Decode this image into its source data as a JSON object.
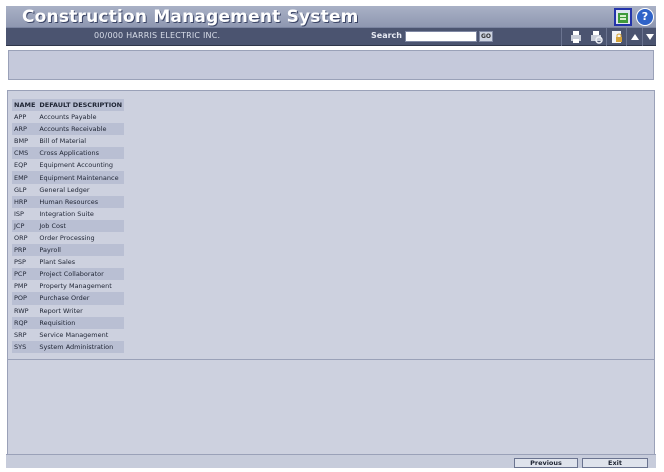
{
  "app": {
    "title": "Construction Management System"
  },
  "toolbar": {
    "company": "00/000  HARRIS ELECTRIC INC.",
    "search_label": "Search",
    "search_value": "",
    "go_label": "GO"
  },
  "table": {
    "headers": {
      "name": "NAME",
      "description": "DEFAULT DESCRIPTION"
    },
    "rows": [
      {
        "code": "APP",
        "description": "Accounts Payable"
      },
      {
        "code": "ARP",
        "description": "Accounts Receivable"
      },
      {
        "code": "BMP",
        "description": "Bill of Material"
      },
      {
        "code": "CMS",
        "description": "Cross Applications"
      },
      {
        "code": "EQP",
        "description": "Equipment Accounting"
      },
      {
        "code": "EMP",
        "description": "Equipment Maintenance"
      },
      {
        "code": "GLP",
        "description": "General Ledger"
      },
      {
        "code": "HRP",
        "description": "Human Resources"
      },
      {
        "code": "ISP",
        "description": "Integration Suite"
      },
      {
        "code": "JCP",
        "description": "Job Cost"
      },
      {
        "code": "ORP",
        "description": "Order Processing"
      },
      {
        "code": "PRP",
        "description": "Payroll"
      },
      {
        "code": "PSP",
        "description": "Plant Sales"
      },
      {
        "code": "PCP",
        "description": "Project Collaborator"
      },
      {
        "code": "PMP",
        "description": "Property Management"
      },
      {
        "code": "POP",
        "description": "Purchase Order"
      },
      {
        "code": "RWP",
        "description": "Report Writer"
      },
      {
        "code": "RQP",
        "description": "Requisition"
      },
      {
        "code": "SRP",
        "description": "Service Management"
      },
      {
        "code": "SYS",
        "description": "System Administration"
      }
    ]
  },
  "footer": {
    "previous_label": "Previous",
    "exit_label": "Exit"
  },
  "icons": {
    "title_right": [
      "application-icon",
      "help-icon"
    ],
    "toolbar_right": [
      "print-icon",
      "print-preview-icon",
      "document-lock-icon",
      "scroll-up-icon",
      "scroll-down-icon"
    ]
  },
  "colors": {
    "titlebar": "#9aa2bb",
    "toolbar": "#4b5470",
    "panel": "#cdd1df",
    "row_alt": "#b9bfd3",
    "accent": "#2233aa"
  }
}
